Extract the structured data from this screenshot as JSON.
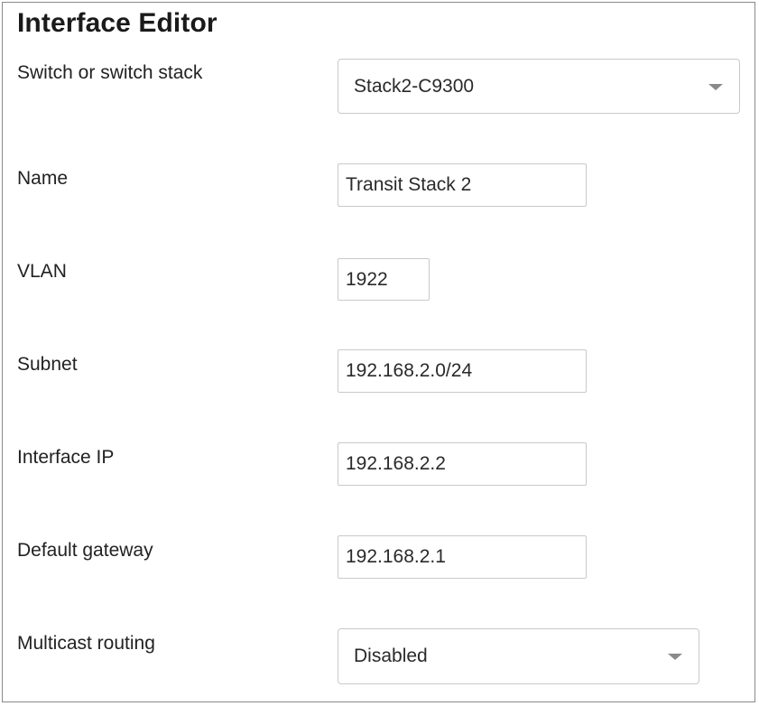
{
  "window": {
    "title": "Interface Editor"
  },
  "fields": {
    "switch": {
      "label": "Switch or switch stack",
      "value": "Stack2-C9300"
    },
    "name": {
      "label": "Name",
      "value": "Transit Stack 2"
    },
    "vlan": {
      "label": "VLAN",
      "value": "1922"
    },
    "subnet": {
      "label": "Subnet",
      "value": "192.168.2.0/24"
    },
    "interface_ip": {
      "label": "Interface IP",
      "value": "192.168.2.2"
    },
    "default_gateway": {
      "label": "Default gateway",
      "value": "192.168.2.1"
    },
    "multicast_routing": {
      "label": "Multicast routing",
      "value": "Disabled"
    }
  },
  "icons": {
    "dropdown": "chevron-down-icon"
  },
  "colors": {
    "border": "#c9c9c9",
    "frame": "#8a8a8a",
    "caret": "#8a8a8a"
  }
}
